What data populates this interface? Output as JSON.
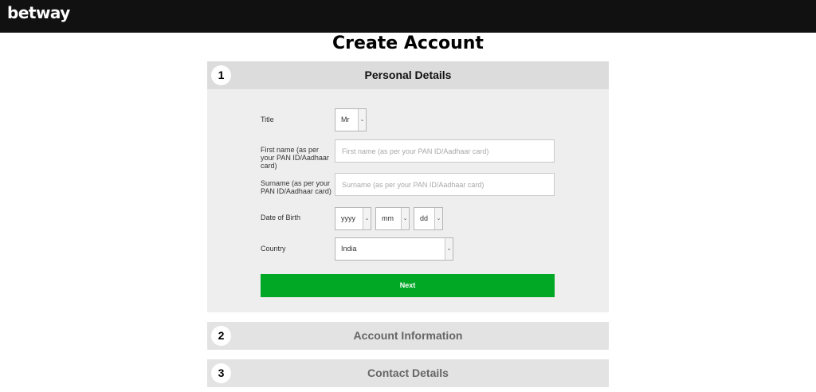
{
  "header": {
    "logo": "betway"
  },
  "page": {
    "title": "Create Account"
  },
  "steps": [
    {
      "number": "1",
      "title": "Personal Details"
    },
    {
      "number": "2",
      "title": "Account Information"
    },
    {
      "number": "3",
      "title": "Contact Details"
    }
  ],
  "form": {
    "title_label": "Title",
    "title_value": "Mr",
    "first_name_label": "First name (as per your PAN ID/Aadhaar card)",
    "first_name_placeholder": "First name (as per your PAN ID/Aadhaar card)",
    "surname_label": "Surname (as per your PAN ID/Aadhaar card)",
    "surname_placeholder": "Surname (as per your PAN ID/Aadhaar card)",
    "dob_label": "Date of Birth",
    "dob_year": "yyyy",
    "dob_month": "mm",
    "dob_day": "dd",
    "country_label": "Country",
    "country_value": "India",
    "next_label": "Next"
  },
  "colors": {
    "topbar": "#111111",
    "next_button": "#00a826",
    "panel": "#eeeeee"
  },
  "icons": {
    "dropdown": "chevron-down-icon"
  }
}
